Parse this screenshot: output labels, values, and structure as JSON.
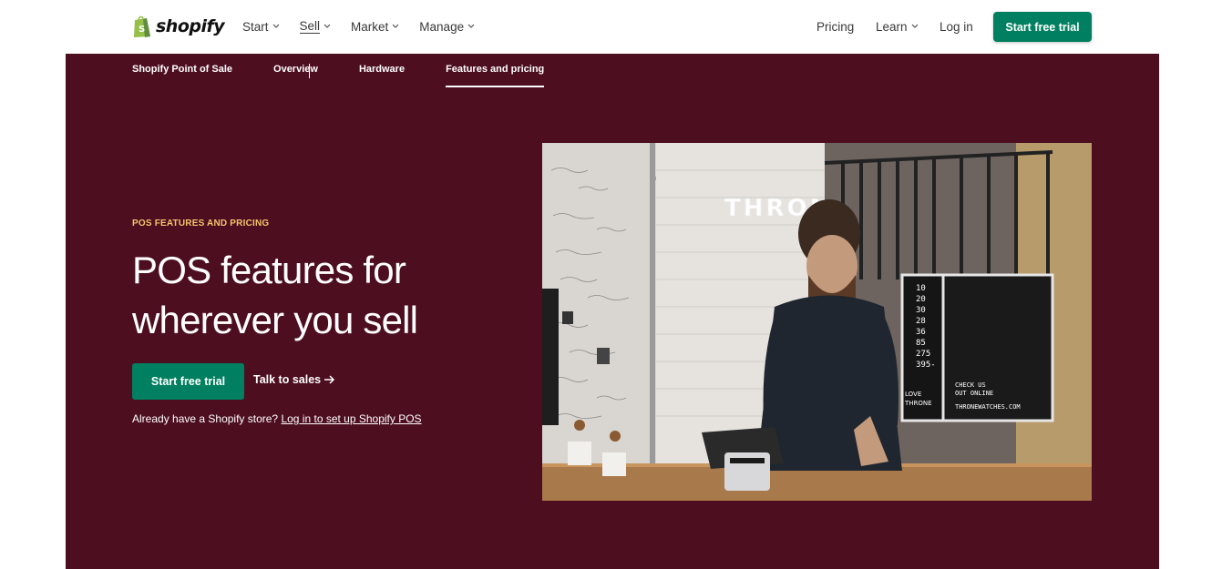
{
  "header": {
    "logo_text": "shopify",
    "nav_left": [
      {
        "label": "Start"
      },
      {
        "label": "Sell"
      },
      {
        "label": "Market"
      },
      {
        "label": "Manage"
      }
    ],
    "nav_right": {
      "pricing": "Pricing",
      "learn": "Learn",
      "login": "Log in",
      "cta": "Start free trial"
    }
  },
  "subnav": {
    "items": [
      "Shopify Point of Sale",
      "Overview",
      "Hardware",
      "Features and pricing"
    ],
    "active": "Features and pricing"
  },
  "hero": {
    "eyebrow": "POS FEATURES AND PRICING",
    "headline": "POS features for wherever you sell",
    "primary_cta": "Start free trial",
    "secondary_cta": "Talk to sales",
    "login_prefix": "Already have a Shopify store?",
    "login_link": "Log in to set up Shopify POS",
    "photo_texts": {
      "sign": "THRONE",
      "numbers": [
        "10",
        "20",
        "30",
        "28",
        "36",
        "85",
        "275",
        "395-"
      ],
      "board_line1": "CHECK US",
      "board_line2": "OUT ONLINE",
      "board_url": "THRONEWATCHES.COM",
      "sticker_line1": "LOVE",
      "sticker_line2": "THRONE"
    }
  },
  "colors": {
    "brand_green": "#008060",
    "hero_bg": "#4d0e20",
    "eyebrow": "#f4c36b"
  }
}
